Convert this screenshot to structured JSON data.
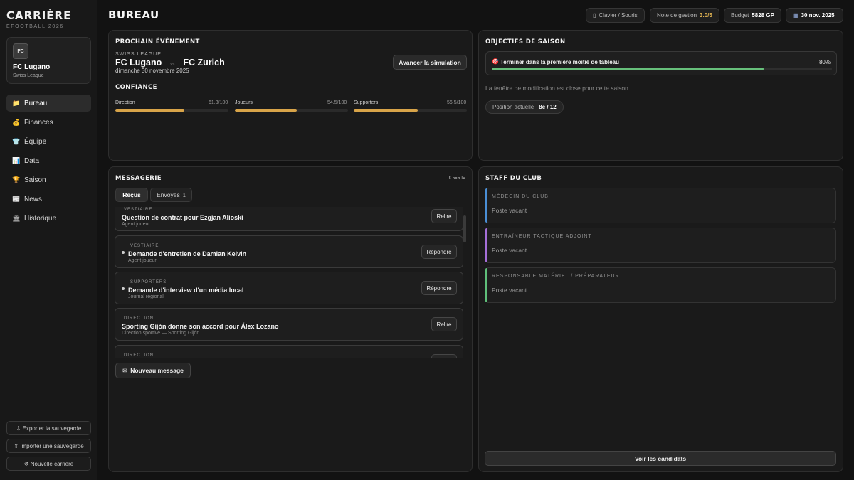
{
  "sidebar": {
    "brand_title": "CARRIÈRE",
    "brand_sub": "EFOOTBALL 2026",
    "club": {
      "logo_text": "FC",
      "name": "FC Lugano",
      "league": "Swiss League"
    },
    "nav": [
      {
        "label": "Bureau",
        "icon": "folder-icon",
        "glyph": "📁",
        "active": true
      },
      {
        "label": "Finances",
        "icon": "money-bag-icon",
        "glyph": "💰",
        "active": false
      },
      {
        "label": "Équipe",
        "icon": "shirt-icon",
        "glyph": "👕",
        "active": false
      },
      {
        "label": "Data",
        "icon": "bar-chart-icon",
        "glyph": "📊",
        "active": false
      },
      {
        "label": "Saison",
        "icon": "trophy-icon",
        "glyph": "🏆",
        "active": false
      },
      {
        "label": "News",
        "icon": "newspaper-icon",
        "glyph": "📰",
        "active": false
      },
      {
        "label": "Historique",
        "icon": "museum-icon",
        "glyph": "🏛",
        "active": false
      }
    ],
    "export_label": "⇩ Exporter la sauvegarde",
    "import_label": "⇧ Importer une sauvegarde",
    "new_label": "↺ Nouvelle carrière"
  },
  "header": {
    "title": "BUREAU",
    "input_mode": "Clavier / Souris",
    "rating_label": "Note de gestion",
    "rating_value": "3.0/5",
    "budget_label": "Budget",
    "budget_value": "5828 GP",
    "date": "30 nov. 2025",
    "colors": {
      "gold": "#e3b553"
    }
  },
  "next_event": {
    "title": "PROCHAIN ÉVÉNEMENT",
    "league": "SWISS LEAGUE",
    "home": "FC Lugano",
    "vs": "vs",
    "away": "FC Zurich",
    "date": "dimanche 30 novembre 2025",
    "button": "Avancer la simulation"
  },
  "confidence": {
    "title": "CONFIANCE",
    "items": [
      {
        "label": "Direction",
        "value_text": "61.3/100",
        "value": 61.3
      },
      {
        "label": "Joueurs",
        "value_text": "54.5/100",
        "value": 54.5
      },
      {
        "label": "Supporters",
        "value_text": "56.5/100",
        "value": 56.5
      }
    ],
    "bar_color": "#d8a449"
  },
  "objectives": {
    "title": "OBJECTIFS DE SAISON",
    "goal_label": "Terminer dans la première moitié de tableau",
    "goal_percent_text": "80%",
    "goal_percent": 80,
    "goal_color": "#67c07b",
    "note": "La fenêtre de modification est close pour cette saison.",
    "position_label": "Position actuelle",
    "position_value": "8e / 12"
  },
  "messages": {
    "title": "MESSAGERIE",
    "unread_text": "5 non lu",
    "tab_received": "Reçus",
    "tab_sent": "Envoyés",
    "tab_sent_count": "1",
    "items": [
      {
        "category": "VESTIAIRE",
        "subject": "Question de contrat pour Ezgjan Alioski",
        "from": "Agent joueur",
        "action": "Relire",
        "unread": false
      },
      {
        "category": "VESTIAIRE",
        "subject": "Demande d'entretien de Damian Kelvin",
        "from": "Agent joueur",
        "action": "Répondre",
        "unread": true
      },
      {
        "category": "SUPPORTERS",
        "subject": "Demande d'interview d'un média local",
        "from": "Journal régional",
        "action": "Répondre",
        "unread": true
      },
      {
        "category": "DIRECTION",
        "subject": "Sporting Gijón donne son accord pour Álex Lozano",
        "from": "Direction sportive — Sporting Gijón",
        "action": "Relire",
        "unread": false
      },
      {
        "category": "DIRECTION",
        "subject": "",
        "from": "",
        "action": "",
        "unread": false
      }
    ],
    "new_message": "Nouveau message"
  },
  "staff": {
    "title": "STAFF DU CLUB",
    "members": [
      {
        "role": "MÉDECIN DU CLUB",
        "status": "Poste vacant",
        "accent": "#4a8fd6"
      },
      {
        "role": "ENTRAÎNEUR TACTIQUE ADJOINT",
        "status": "Poste vacant",
        "accent": "#a56fd8"
      },
      {
        "role": "RESPONSABLE MATÉRIEL / PRÉPARATEUR",
        "status": "Poste vacant",
        "accent": "#5fbf7a"
      }
    ],
    "candidates_button": "Voir les candidats"
  }
}
